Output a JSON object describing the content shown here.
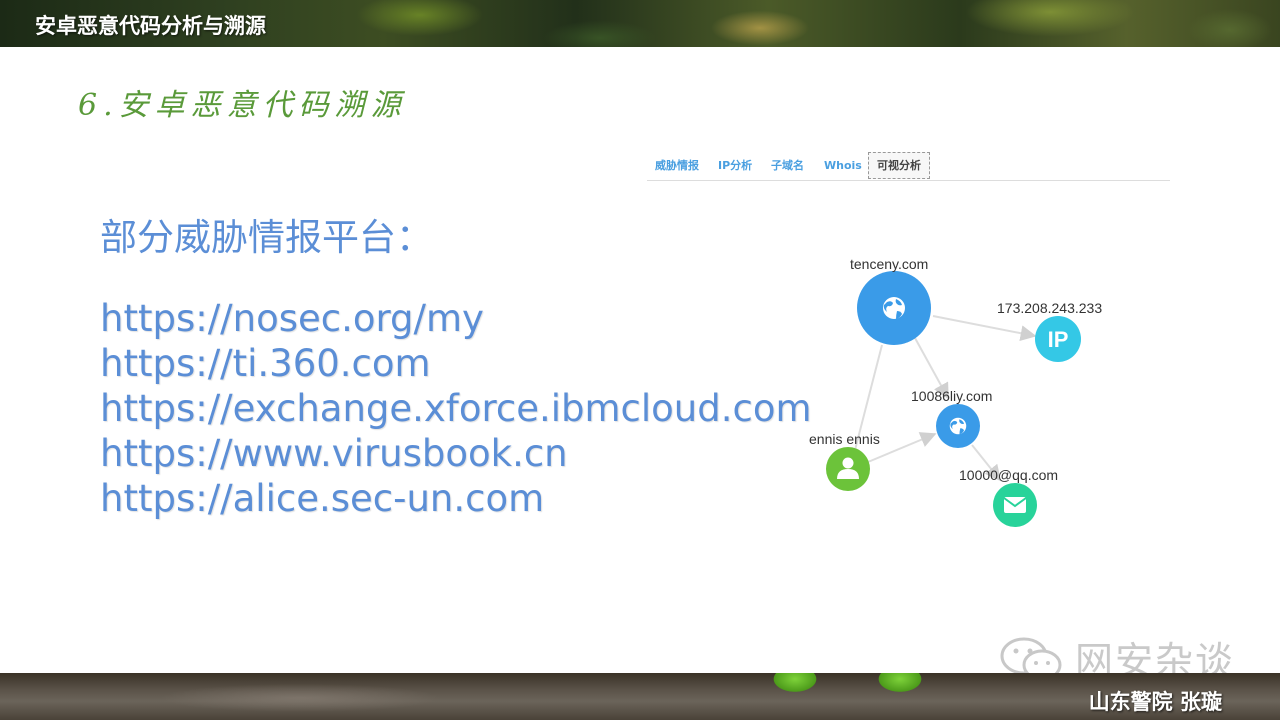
{
  "header": {
    "title": "安卓恶意代码分析与溯源"
  },
  "section": {
    "title": "6.安卓恶意代码溯源"
  },
  "content": {
    "heading": "部分威胁情报平台：",
    "links": [
      "https://nosec.org/my",
      "https://ti.360.com",
      "https://exchange.xforce.ibmcloud.com",
      "https://www.virusbook.cn",
      "https://alice.sec-un.com"
    ]
  },
  "tabs": [
    {
      "label": "威胁情报",
      "active": false
    },
    {
      "label": "IP分析",
      "active": false
    },
    {
      "label": "子域名",
      "active": false
    },
    {
      "label": "Whois",
      "active": false
    },
    {
      "label": "可视分析",
      "active": true
    }
  ],
  "graph": {
    "nodes": [
      {
        "id": "domain1",
        "label": "tenceny.com",
        "type": "globe",
        "color": "#3a9be8"
      },
      {
        "id": "ip1",
        "label": "173.208.243.233",
        "type": "ip",
        "color": "#34c8e6",
        "icon_text": "IP"
      },
      {
        "id": "domain2",
        "label": "10086liy.com",
        "type": "globe",
        "color": "#3a9be8"
      },
      {
        "id": "person1",
        "label": "ennis ennis",
        "type": "person",
        "color": "#6cc33a"
      },
      {
        "id": "email1",
        "label": "10000@qq.com",
        "type": "email",
        "color": "#28d39a"
      }
    ],
    "edges": [
      [
        "domain1",
        "ip1"
      ],
      [
        "domain1",
        "domain2"
      ],
      [
        "domain1",
        "person1"
      ],
      [
        "person1",
        "domain2"
      ],
      [
        "domain2",
        "email1"
      ]
    ]
  },
  "watermark": {
    "text": "网安杂谈",
    "icon": "wechat-icon"
  },
  "footer": {
    "author": "山东警院  张璇"
  }
}
